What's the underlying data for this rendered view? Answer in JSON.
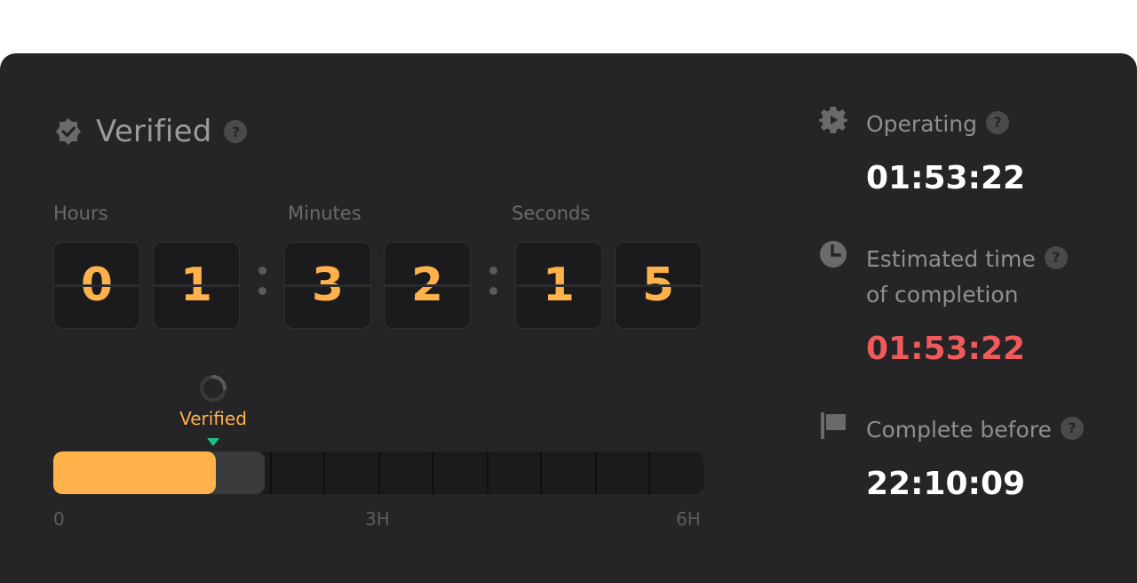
{
  "status": {
    "label": "Verified",
    "help": "?"
  },
  "countdown": {
    "labels": {
      "hours": "Hours",
      "minutes": "Minutes",
      "seconds": "Seconds"
    },
    "digits": [
      "0",
      "1",
      "3",
      "2",
      "1",
      "5"
    ]
  },
  "progress": {
    "marker_label": "Verified",
    "completed_fraction": 0.25,
    "pending_fraction": 0.325,
    "axis": [
      "0",
      "3H",
      "6H"
    ]
  },
  "side": {
    "operating": {
      "label": "Operating",
      "help": "?",
      "value": "01:53:22"
    },
    "estimated": {
      "label_line1": "Estimated time",
      "label_line2": "of completion",
      "help": "?",
      "value": "01:53:22"
    },
    "complete_before": {
      "label": "Complete before",
      "help": "?",
      "value": "22:10:09"
    }
  },
  "colors": {
    "accent": "#ffb14a",
    "danger": "#f05a5a",
    "marker": "#1fc18b",
    "card": "#252427"
  },
  "icons": [
    "verified-badge-icon",
    "help-icon",
    "loading-spinner-icon",
    "gear-icon",
    "clock-icon",
    "flag-icon"
  ]
}
